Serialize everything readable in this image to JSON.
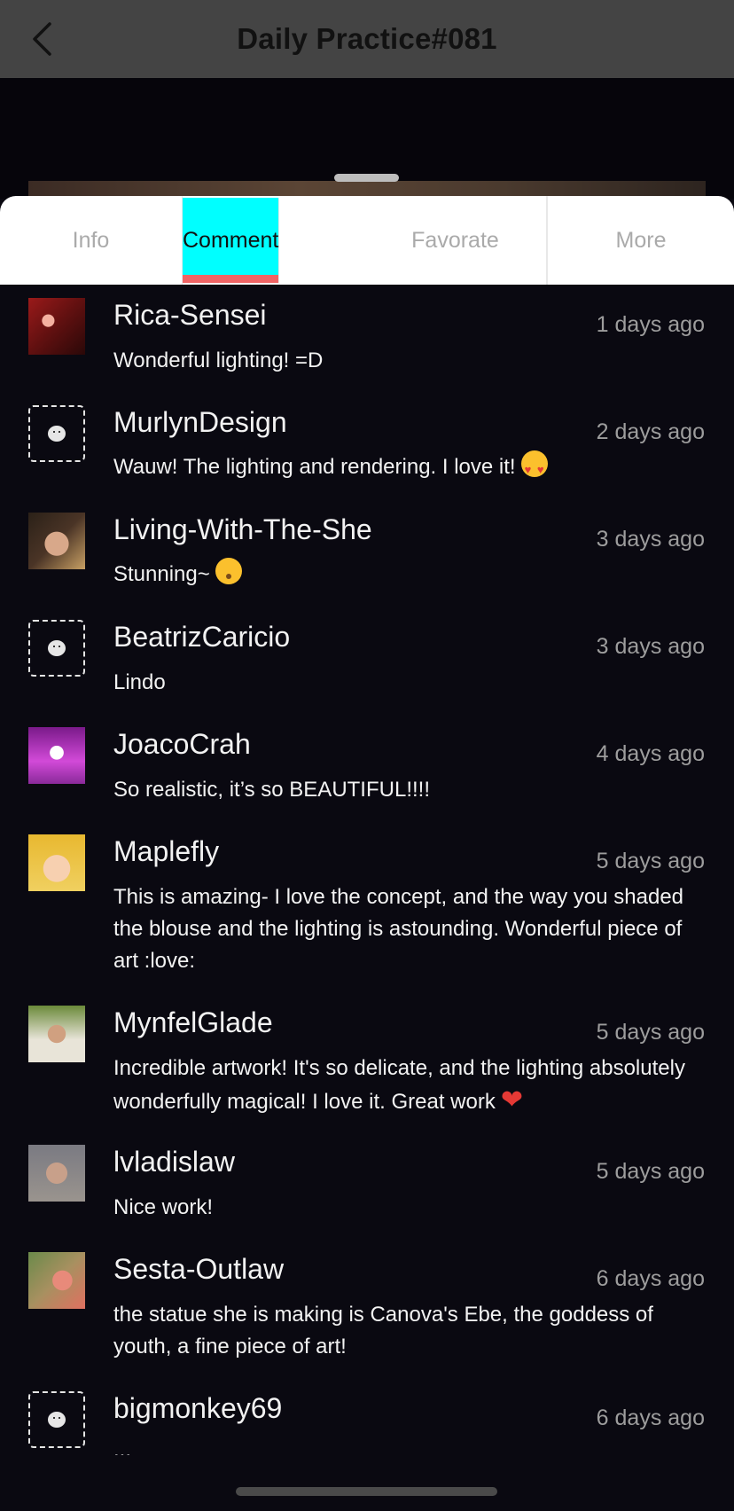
{
  "header": {
    "title": "Daily Practice#081",
    "back_icon": "chevron-left-icon"
  },
  "tabs": [
    {
      "label": "Info",
      "active": false
    },
    {
      "label": "Comment",
      "active": true
    },
    {
      "label": "Favorate",
      "active": false
    },
    {
      "label": "More",
      "active": false
    }
  ],
  "colors": {
    "active_tab": "#00ffff",
    "tab_underline": "#f06464",
    "background": "#0a0911",
    "header": "#444444"
  },
  "comments": [
    {
      "user": "Rica-Sensei",
      "time": "1 days ago",
      "text": "Wonderful lighting! =D",
      "avatar": "user-avatar"
    },
    {
      "user": "MurlynDesign",
      "time": "2 days ago",
      "text": "Wauw! The lighting and rendering. I love it!",
      "emoji": "heart-eyes-emoji",
      "avatar": "default-avatar"
    },
    {
      "user": "Living-With-The-She",
      "time": "3 days ago",
      "text": "Stunning~",
      "emoji": "hushed-face-emoji",
      "avatar": "user-avatar"
    },
    {
      "user": "BeatrizCaricio",
      "time": "3 days ago",
      "text": "Lindo",
      "avatar": "default-avatar"
    },
    {
      "user": "JoacoCrah",
      "time": "4 days ago",
      "text": "So realistic, it’s so BEAUTIFUL!!!!",
      "avatar": "user-avatar"
    },
    {
      "user": "Maplefly",
      "time": "5 days ago",
      "text": "This is amazing- I love the concept, and the way you shaded the blouse and the lighting is astounding. Wonderful piece of art :love:",
      "avatar": "user-avatar"
    },
    {
      "user": "MynfelGlade",
      "time": "5 days ago",
      "text": "Incredible artwork! It's so delicate, and the lighting absolutely wonderfully magical! I love it. Great work",
      "emoji": "red-heart-emoji",
      "avatar": "user-avatar"
    },
    {
      "user": "lvladislaw",
      "time": "5 days ago",
      "text": "Nice work!",
      "avatar": "user-avatar"
    },
    {
      "user": "Sesta-Outlaw",
      "time": "6 days ago",
      "text": "the statue she is making is Canova's Ebe, the goddess of youth, a fine piece of art!",
      "avatar": "user-avatar"
    },
    {
      "user": "bigmonkey69",
      "time": "6 days ago",
      "text": "...",
      "avatar": "default-avatar"
    }
  ]
}
